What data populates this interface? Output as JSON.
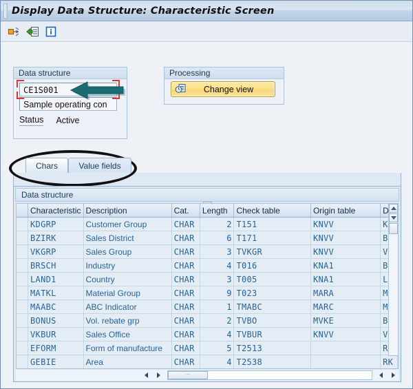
{
  "window": {
    "title": "Display Data Structure: Characteristic Screen"
  },
  "toolbar": {
    "buttons": [
      {
        "name": "other-object-icon",
        "tooltip": "Other object"
      },
      {
        "name": "display-change-icon",
        "tooltip": "Display/Change"
      },
      {
        "name": "info-icon",
        "tooltip": "Information"
      }
    ]
  },
  "data_structure_group": {
    "legend": "Data structure",
    "name_value": "CE1S001",
    "name_placeholder": "",
    "description_value": "Sample operating con",
    "status_label": "Status",
    "status_value": "Active"
  },
  "processing_group": {
    "legend": "Processing",
    "change_view_label": "Change view",
    "change_view_icon": "change-view-icon"
  },
  "annotations": {
    "arrow_color": "#1b6b72",
    "focus_box_color": "#d93636",
    "ellipse_color": "#111111"
  },
  "tabs": {
    "items": [
      {
        "label": "Chars",
        "active": true
      },
      {
        "label": "Value fields",
        "active": false
      }
    ]
  },
  "grid": {
    "title": "Data structure",
    "columns": [
      "Characteristic",
      "Description",
      "Cat.",
      "Length",
      "Check table",
      "Origin table",
      "Dc"
    ],
    "rows": [
      {
        "characteristic": "KDGRP",
        "description": "Customer Group",
        "cat": "CHAR",
        "length": "2",
        "check_table": "T151",
        "origin_table": "KNVV",
        "dc": "KD"
      },
      {
        "characteristic": "BZIRK",
        "description": "Sales District",
        "cat": "CHAR",
        "length": "6",
        "check_table": "T171",
        "origin_table": "KNVV",
        "dc": "BZ"
      },
      {
        "characteristic": "VKGRP",
        "description": "Sales Group",
        "cat": "CHAR",
        "length": "3",
        "check_table": "TVKGR",
        "origin_table": "KNVV",
        "dc": "VK"
      },
      {
        "characteristic": "BRSCH",
        "description": "Industry",
        "cat": "CHAR",
        "length": "4",
        "check_table": "T016",
        "origin_table": "KNA1",
        "dc": "BR"
      },
      {
        "characteristic": "LAND1",
        "description": "Country",
        "cat": "CHAR",
        "length": "3",
        "check_table": "T005",
        "origin_table": "KNA1",
        "dc": "LA"
      },
      {
        "characteristic": "MATKL",
        "description": "Material Group",
        "cat": "CHAR",
        "length": "9",
        "check_table": "T023",
        "origin_table": "MARA",
        "dc": "MA"
      },
      {
        "characteristic": "MAABC",
        "description": "ABC Indicator",
        "cat": "CHAR",
        "length": "1",
        "check_table": "TMABC",
        "origin_table": "MARC",
        "dc": "MA"
      },
      {
        "characteristic": "BONUS",
        "description": "Vol. rebate grp",
        "cat": "CHAR",
        "length": "2",
        "check_table": "TVBO",
        "origin_table": "MVKE",
        "dc": "BO"
      },
      {
        "characteristic": "VKBUR",
        "description": "Sales Office",
        "cat": "CHAR",
        "length": "4",
        "check_table": "TVBUR",
        "origin_table": "KNVV",
        "dc": "VK"
      },
      {
        "characteristic": "EFORM",
        "description": "Form of manufacture",
        "cat": "CHAR",
        "length": "5",
        "check_table": "T2513",
        "origin_table": "",
        "dc": "RK"
      },
      {
        "characteristic": "GEBIE",
        "description": "Area",
        "cat": "CHAR",
        "length": "4",
        "check_table": "T2538",
        "origin_table": "",
        "dc": "RK"
      }
    ]
  },
  "scrollbars": {
    "vertical_up": "scroll-up-arrow",
    "vertical_down": "scroll-down-arrow",
    "horizontal_left": "scroll-left-arrow",
    "horizontal_right": "scroll-right-arrow"
  }
}
